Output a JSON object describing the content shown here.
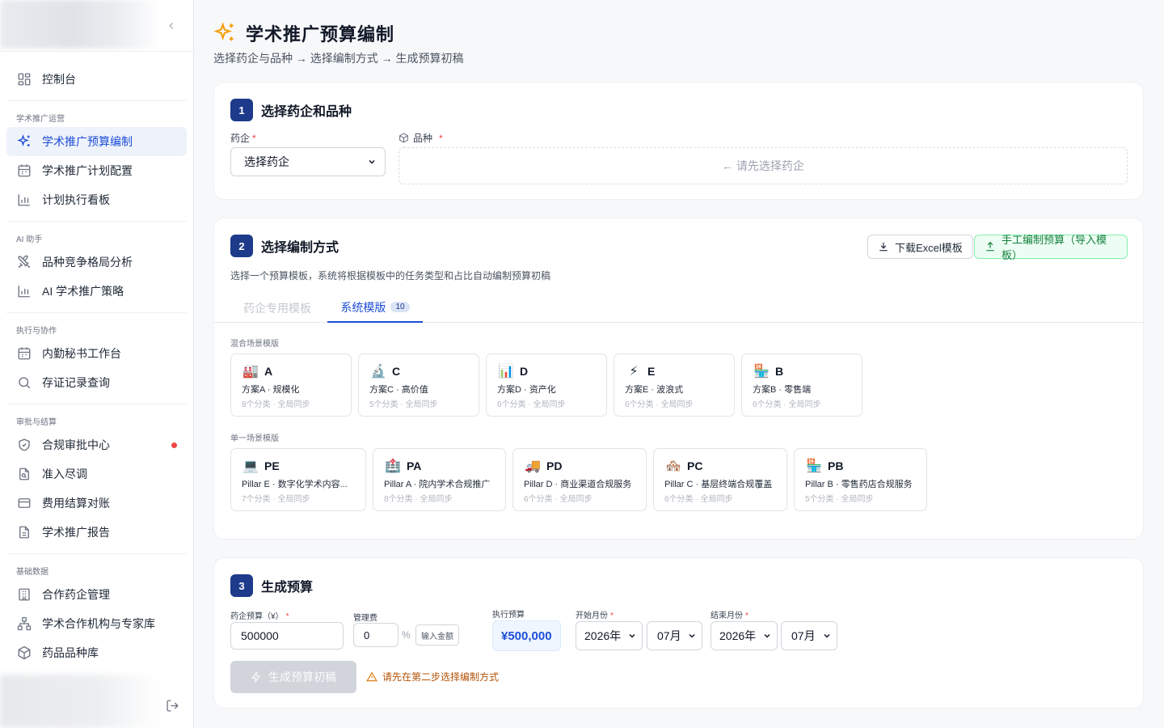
{
  "sidebar": {
    "items": {
      "dashboard": "控制台",
      "budget": "学术推广预算编制",
      "plan_config": "学术推广计划配置",
      "exec_board": "计划执行看板",
      "competition": "品种竞争格局分析",
      "ai_strategy": "AI 学术推广策略",
      "secretary": "内勤秘书工作台",
      "evidence": "存证记录查询",
      "compliance": "合规审批中心",
      "due_diligence": "准入尽调",
      "settlement": "费用结算对账",
      "report": "学术推广报告",
      "partner_pharma": "合作药企管理",
      "institutions": "学术合作机构与专家库",
      "drug_library": "药品品种库"
    },
    "groups": {
      "ops": "学术推广运营",
      "ai": "AI 助手",
      "exec": "执行与协作",
      "approval": "审批与结算",
      "base": "基础数据"
    }
  },
  "page": {
    "title": "学术推广预算编制",
    "subtitle": "选择药企与品种 → 选择编制方式 → 生成预算初稿"
  },
  "step1": {
    "num": "1",
    "title": "选择药企和品种",
    "pharma_label": "药企",
    "pharma_value": "选择药企",
    "variety_label": "品种",
    "variety_placeholder": "← 请先选择药企"
  },
  "step2": {
    "num": "2",
    "title": "选择编制方式",
    "desc": "选择一个预算模板，系统将根据模板中的任务类型和占比自动编制预算初稿",
    "download_btn": "下载Excel模板",
    "manual_btn": "手工编制预算（导入模板）",
    "tab_pharma": "药企专用模板",
    "tab_system": "系统模版",
    "tab_system_count": "10",
    "mixed_label": "混合场景模版",
    "single_label": "单一场景模版",
    "mixed": [
      {
        "emoji": "🏭",
        "code": "A",
        "name": "方案A · 规模化",
        "meta": "8个分类 · 全局同步"
      },
      {
        "emoji": "🔬",
        "code": "C",
        "name": "方案C · 高价值",
        "meta": "5个分类 · 全局同步"
      },
      {
        "emoji": "📊",
        "code": "D",
        "name": "方案D · 资产化",
        "meta": "6个分类 · 全局同步"
      },
      {
        "emoji": "⚡",
        "code": "E",
        "name": "方案E · 波浪式",
        "meta": "6个分类 · 全局同步"
      },
      {
        "emoji": "🏪",
        "code": "B",
        "name": "方案B · 零售端",
        "meta": "6个分类 · 全局同步"
      }
    ],
    "single": [
      {
        "emoji": "💻",
        "code": "PE",
        "name": "Pillar E · 数字化学术内容...",
        "meta": "7个分类 · 全局同步"
      },
      {
        "emoji": "🏥",
        "code": "PA",
        "name": "Pillar A · 院内学术合规推广",
        "meta": "8个分类 · 全局同步"
      },
      {
        "emoji": "🚚",
        "code": "PD",
        "name": "Pillar D · 商业渠道合规服务",
        "meta": "6个分类 · 全局同步"
      },
      {
        "emoji": "🏘️",
        "code": "PC",
        "name": "Pillar C · 基层终端合规覆盖",
        "meta": "6个分类 · 全局同步"
      },
      {
        "emoji": "🏪",
        "code": "PB",
        "name": "Pillar B · 零售药店合规服务",
        "meta": "5个分类 · 全局同步"
      }
    ]
  },
  "step3": {
    "num": "3",
    "title": "生成预算",
    "budget_label": "药企预算（¥）",
    "budget_value": "500000",
    "fee_label": "管理费",
    "fee_value": "0",
    "pct": "%",
    "amount_btn": "输入金额",
    "exec_label": "执行预算",
    "exec_value": "¥500,000",
    "start_label": "开始月份",
    "start_year": "2026年",
    "start_month": "07月",
    "end_label": "结束月份",
    "end_year": "2026年",
    "end_month": "07月",
    "generate_btn": "生成预算初稿",
    "warning": "请先在第二步选择编制方式"
  },
  "colors": {
    "accent": "#1d4ed8",
    "step_badge": "#1e3a8a",
    "warning": "#b45309",
    "green": "#15803d"
  }
}
